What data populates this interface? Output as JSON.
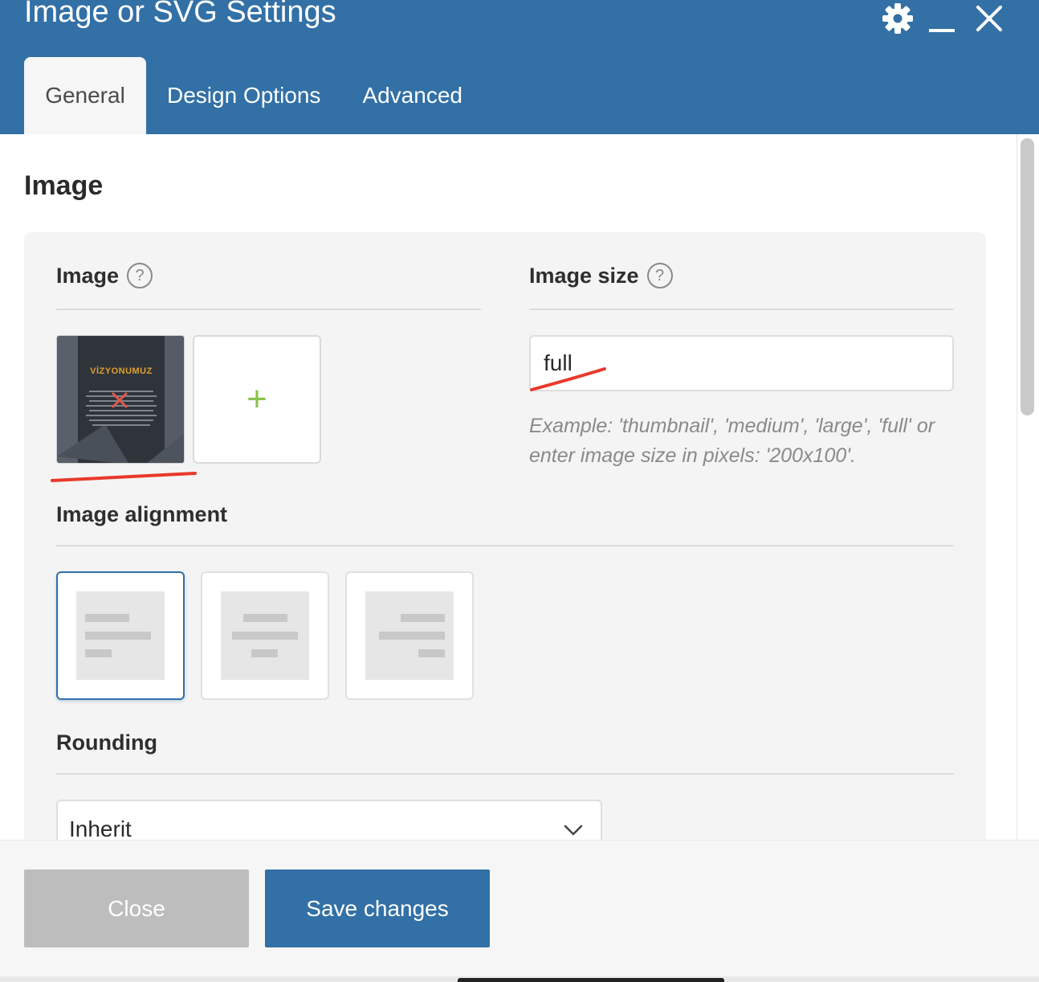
{
  "window": {
    "title": "Image or SVG Settings",
    "icons": [
      "gear-icon",
      "minimize-icon",
      "close-icon"
    ]
  },
  "tabs": [
    {
      "label": "General",
      "active": true
    },
    {
      "label": "Design Options",
      "active": false
    },
    {
      "label": "Advanced",
      "active": false
    }
  ],
  "section": {
    "title": "Image"
  },
  "image_field": {
    "label": "Image",
    "help": "?",
    "thumbnail_caption": "VİZYONUMUZ",
    "add_symbol": "+"
  },
  "image_size_field": {
    "label": "Image size",
    "help": "?",
    "value": "full",
    "hint": "Example: 'thumbnail', 'medium', 'large', 'full' or enter image size in pixels: '200x100'."
  },
  "alignment_field": {
    "label": "Image alignment",
    "options": [
      "left",
      "center",
      "right"
    ],
    "selected": "left"
  },
  "rounding_field": {
    "label": "Rounding",
    "value": "Inherit"
  },
  "footer": {
    "close_label": "Close",
    "save_label": "Save changes"
  },
  "colors": {
    "header": "#3270a6",
    "accent": "#3270a6",
    "add_plus": "#8bc34a",
    "annotation": "#e8392b"
  }
}
